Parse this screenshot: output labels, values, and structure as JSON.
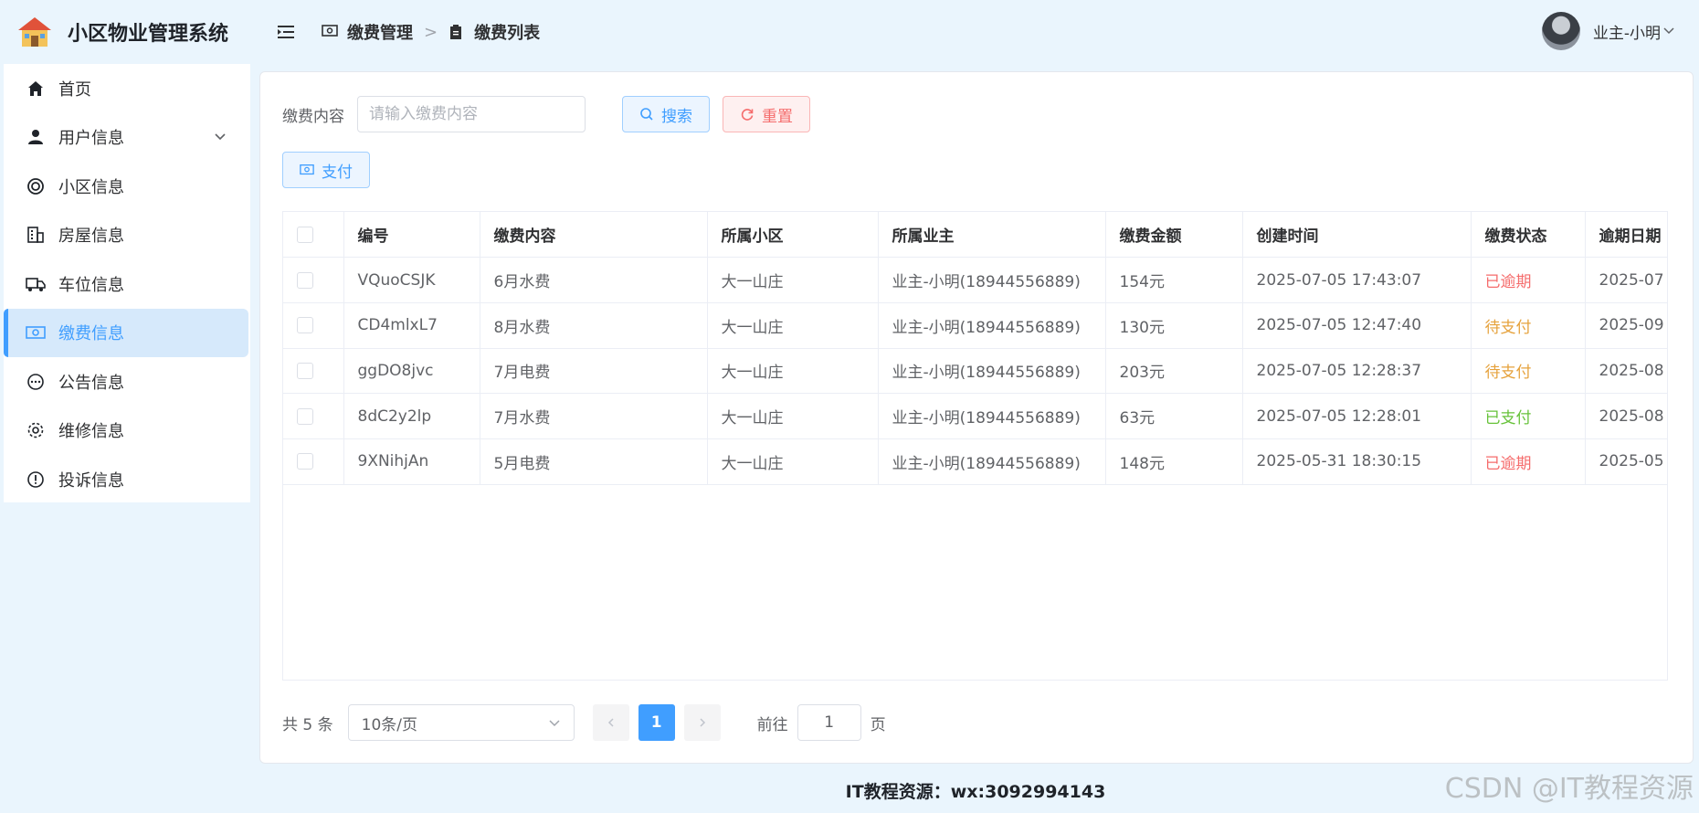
{
  "app": {
    "title": "小区物业管理系统"
  },
  "sidebar": {
    "items": [
      {
        "label": "首页",
        "icon": "home-icon"
      },
      {
        "label": "用户信息",
        "icon": "user-icon",
        "expandable": true
      },
      {
        "label": "小区信息",
        "icon": "lifebuoy-icon"
      },
      {
        "label": "房屋信息",
        "icon": "building-icon"
      },
      {
        "label": "车位信息",
        "icon": "truck-icon"
      },
      {
        "label": "缴费信息",
        "icon": "money-icon",
        "active": true
      },
      {
        "label": "公告信息",
        "icon": "chat-icon"
      },
      {
        "label": "维修信息",
        "icon": "gear-icon"
      },
      {
        "label": "投诉信息",
        "icon": "warning-icon"
      }
    ]
  },
  "header": {
    "breadcrumb": [
      {
        "label": "缴费管理",
        "icon": "money-icon"
      },
      {
        "label": "缴费列表",
        "icon": "clipboard-icon"
      }
    ],
    "user_name": "业主-小明"
  },
  "search": {
    "label": "缴费内容",
    "placeholder": "请输入缴费内容",
    "search_label": "搜索",
    "reset_label": "重置"
  },
  "toolbar": {
    "pay_label": "支付"
  },
  "table": {
    "headers": [
      "编号",
      "缴费内容",
      "所属小区",
      "所属业主",
      "缴费金额",
      "创建时间",
      "缴费状态",
      "逾期日期"
    ],
    "rows": [
      {
        "id": "VQuoCSJK",
        "content": "6月水费",
        "community": "大一山庄",
        "owner": "业主-小明(18944556889)",
        "amount": "154元",
        "created": "2025-07-05 17:43:07",
        "status": "已逾期",
        "status_type": "overdue",
        "due": "2025-07"
      },
      {
        "id": "CD4mlxL7",
        "content": "8月水费",
        "community": "大一山庄",
        "owner": "业主-小明(18944556889)",
        "amount": "130元",
        "created": "2025-07-05 12:47:40",
        "status": "待支付",
        "status_type": "pending",
        "due": "2025-09"
      },
      {
        "id": "ggDO8jvc",
        "content": "7月电费",
        "community": "大一山庄",
        "owner": "业主-小明(18944556889)",
        "amount": "203元",
        "created": "2025-07-05 12:28:37",
        "status": "待支付",
        "status_type": "pending",
        "due": "2025-08"
      },
      {
        "id": "8dC2y2lp",
        "content": "7月水费",
        "community": "大一山庄",
        "owner": "业主-小明(18944556889)",
        "amount": "63元",
        "created": "2025-07-05 12:28:01",
        "status": "已支付",
        "status_type": "paid",
        "due": "2025-08"
      },
      {
        "id": "9XNihjAn",
        "content": "5月电费",
        "community": "大一山庄",
        "owner": "业主-小明(18944556889)",
        "amount": "148元",
        "created": "2025-05-31 18:30:15",
        "status": "已逾期",
        "status_type": "overdue",
        "due": "2025-05"
      }
    ]
  },
  "pagination": {
    "total_text": "共 5 条",
    "page_size": "10条/页",
    "current_page": "1",
    "goto_label": "前往",
    "goto_value": "1",
    "page_suffix": "页"
  },
  "footer": {
    "text": "IT教程资源：wx:3092994143"
  },
  "watermark": {
    "text": "CSDN @IT教程资源"
  },
  "colors": {
    "accent": "#409eff",
    "danger": "#f56c6c",
    "warning": "#e6a23c",
    "success": "#67c23a"
  }
}
